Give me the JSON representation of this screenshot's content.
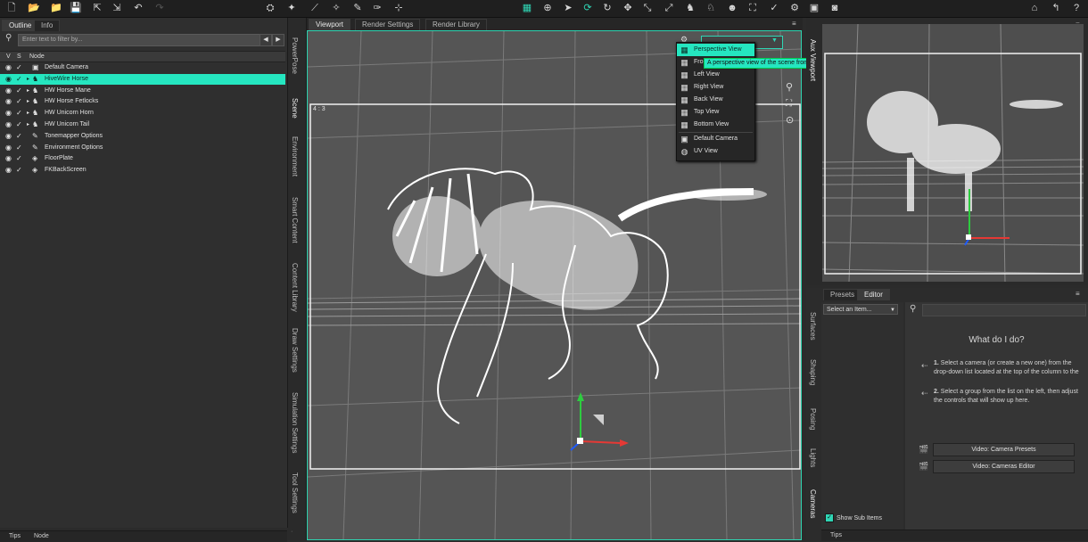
{
  "toolbar": {
    "file_icons": [
      "new-file-icon",
      "open-folder-icon",
      "open-recent-icon",
      "save-icon",
      "import-icon",
      "export-icon",
      "undo-icon",
      "redo-icon"
    ],
    "scene_icons": [
      "node-selection-icon",
      "spot-render-icon",
      "joint-editor-icon",
      "geometry-editor-icon",
      "node-weight-icon",
      "surface-selection-icon",
      "region-nav-icon"
    ],
    "center_icons": [
      "universal-tool-icon",
      "active-pose-icon",
      "select-arrow-icon",
      "rotate-tool-icon",
      "twist-tool-icon",
      "translate-tool-icon",
      "scale-tool-icon",
      "transform-icon",
      "figure-icon",
      "pose-icon",
      "camera-add-icon",
      "light-add-icon",
      "render-settings-icon",
      "render-icon"
    ],
    "right_icons": [
      "home-icon",
      "help-arrow-icon",
      "help-icon"
    ]
  },
  "left_panel": {
    "tabs": [
      "Outline",
      "Info"
    ],
    "filter_placeholder": "Enter text to filter by...",
    "columns": {
      "v": "V",
      "s": "S",
      "node": "Node"
    },
    "nodes": [
      {
        "label": "Default Camera",
        "icon": "camera-node-icon",
        "expander": "",
        "selected": false
      },
      {
        "label": "HiveWire Horse",
        "icon": "figure-node-icon",
        "expander": "▸",
        "selected": true
      },
      {
        "label": "HW Horse Mane",
        "icon": "figure-node-icon",
        "expander": "▸",
        "selected": false
      },
      {
        "label": "HW Horse Fetlocks",
        "icon": "figure-node-icon",
        "expander": "▸",
        "selected": false
      },
      {
        "label": "HW Unicorn Horn",
        "icon": "figure-node-icon",
        "expander": "▸",
        "selected": false
      },
      {
        "label": "HW Unicorn Tail",
        "icon": "figure-node-icon",
        "expander": "▸",
        "selected": false
      },
      {
        "label": "Tonemapper Options",
        "icon": "options-node-icon",
        "expander": "",
        "selected": false
      },
      {
        "label": "Environment Options",
        "icon": "options-node-icon",
        "expander": "",
        "selected": false
      },
      {
        "label": "FloorPlate",
        "icon": "prop-node-icon",
        "expander": "",
        "selected": false
      },
      {
        "label": "FKBackScreen",
        "icon": "prop-node-icon",
        "expander": "",
        "selected": false
      }
    ],
    "bottom_tabs": [
      "Tips",
      "Node"
    ]
  },
  "side_tabs": [
    "PowerPose",
    "Scene",
    "Environment",
    "Smart Content",
    "Content Library",
    "Draw Settings",
    "Simulation Settings",
    "Tool Settings"
  ],
  "center": {
    "tabs": [
      "Viewport",
      "Render Settings",
      "Render Library"
    ],
    "aspect_label": "4 : 3",
    "camera_menu": [
      {
        "label": "Perspective View",
        "icon": "view-icon"
      },
      {
        "label": "Front View",
        "icon": "view-icon"
      },
      {
        "label": "Left View",
        "icon": "view-icon"
      },
      {
        "label": "Right View",
        "icon": "view-icon"
      },
      {
        "label": "Back View",
        "icon": "view-icon"
      },
      {
        "label": "Top View",
        "icon": "view-icon"
      },
      {
        "label": "Bottom View",
        "icon": "view-icon"
      },
      {
        "label": "Default Camera",
        "icon": "camera-icon"
      },
      {
        "label": "UV View",
        "icon": "globe-icon"
      }
    ],
    "menu_visible_labels": [
      "Perspective View",
      "Fro",
      "Left View",
      "Right View",
      "Back View",
      "Top View",
      "Bottom View",
      "Default Camera",
      "UV View"
    ],
    "tooltip": "A perspective view of the scene from an arbitrary vantage point."
  },
  "aux": {
    "tab": "Aux Viewport"
  },
  "right_panel": {
    "side_tabs": [
      "Surfaces",
      "Shaping",
      "Posing",
      "Lights",
      "Cameras"
    ],
    "tabs": [
      "Presets",
      "Editor"
    ],
    "select_label": "Select an Item...",
    "heading": "What do I do?",
    "help1_num": "1.",
    "help1": "Select a camera (or create a new one) from the drop-down list located at the top of the column to the left.",
    "help2_num": "2.",
    "help2": "Select a group from the list on the left, then adjust the controls that will show up here.",
    "video_buttons": [
      "Video: Camera Presets",
      "Video: Cameras Editor"
    ],
    "show_sub_items": "Show Sub Items",
    "bottom_tab": "Tips"
  },
  "colors": {
    "accent": "#25e6c0",
    "panel": "#2f2f2f",
    "viewport": "#555555"
  }
}
